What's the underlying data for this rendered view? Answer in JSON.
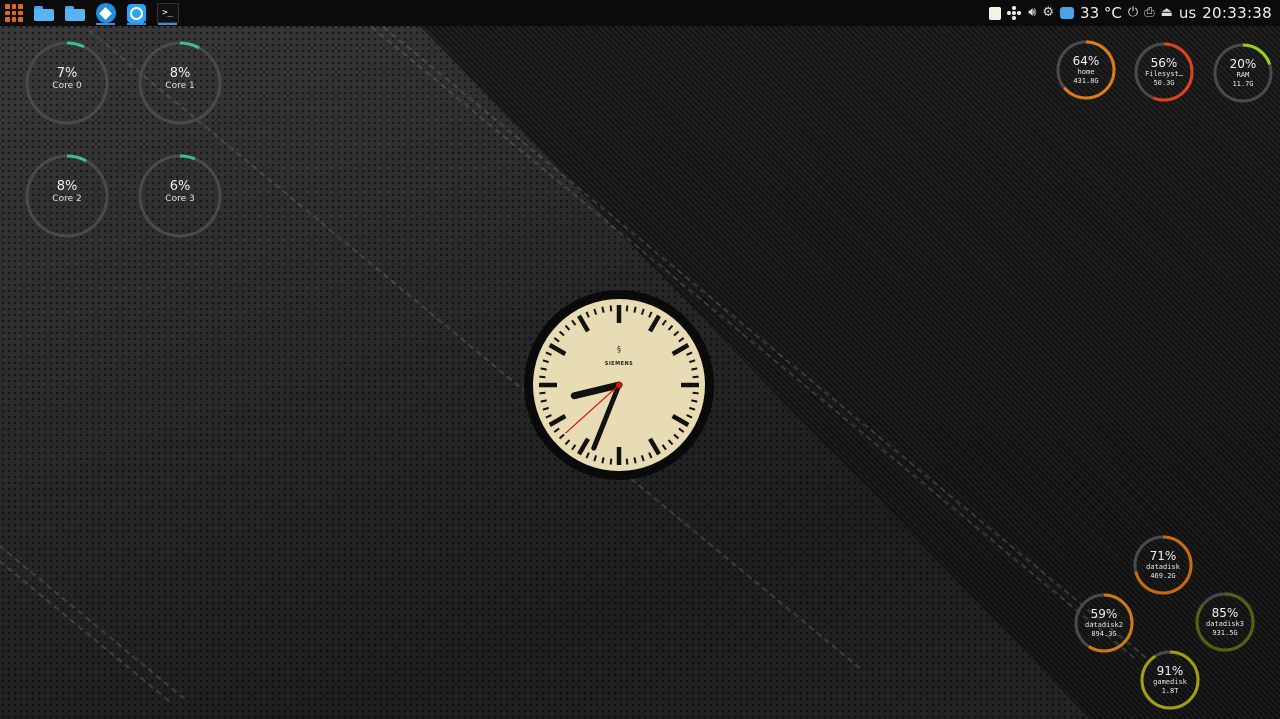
{
  "panel": {
    "apps": [
      {
        "name": "files",
        "icon": "folder-icon",
        "active": false
      },
      {
        "name": "files-2",
        "icon": "folder-icon",
        "active": false
      },
      {
        "name": "kodi",
        "icon": "kodi-icon",
        "active": true
      },
      {
        "name": "obs",
        "icon": "obs-icon",
        "active": true
      },
      {
        "name": "terminal",
        "icon": "terminal-icon",
        "active": true
      }
    ],
    "terminal_glyph": ">_",
    "temperature": "33 °C",
    "keyboard_layout": "us",
    "time": "20:33:38",
    "launcher_color": "#e06a1c"
  },
  "cpu": [
    {
      "label": "Core 0",
      "percent_text": "7%",
      "percent": 7
    },
    {
      "label": "Core 1",
      "percent_text": "8%",
      "percent": 8
    },
    {
      "label": "Core 2",
      "percent_text": "8%",
      "percent": 8
    },
    {
      "label": "Core 3",
      "percent_text": "6%",
      "percent": 6
    }
  ],
  "storage_top": [
    {
      "label": "home",
      "size": "431.8G",
      "percent_text": "64%",
      "percent": 64,
      "color": "#e07a14"
    },
    {
      "label": "Filesyst…",
      "size": "50.3G",
      "percent_text": "56%",
      "percent": 56,
      "color": "#e0401a"
    },
    {
      "label": "RAM",
      "size": "11.7G",
      "percent_text": "20%",
      "percent": 20,
      "color": "#9bd018"
    }
  ],
  "storage_bottom": [
    {
      "label": "datadisk",
      "size": "469.2G",
      "percent_text": "71%",
      "percent": 71,
      "color": "#c86a10"
    },
    {
      "label": "datadisk2",
      "size": "894.3G",
      "percent_text": "59%",
      "percent": 59,
      "color": "#d07a10"
    },
    {
      "label": "datadisk3",
      "size": "931.5G",
      "percent_text": "85%",
      "percent": 85,
      "color": "#5a5f10"
    },
    {
      "label": "gamedisk",
      "size": "1.8T",
      "percent_text": "91%",
      "percent": 91,
      "color": "#a0a010"
    }
  ],
  "clock": {
    "brand": "SIEMENS",
    "hour": 20,
    "minute": 33,
    "second": 38,
    "face_color": "#e8dcb4",
    "second_hand_color": "#e01010"
  },
  "colors": {
    "cpu_arc": "#3dbf8a",
    "track": "#4a4a4a"
  }
}
